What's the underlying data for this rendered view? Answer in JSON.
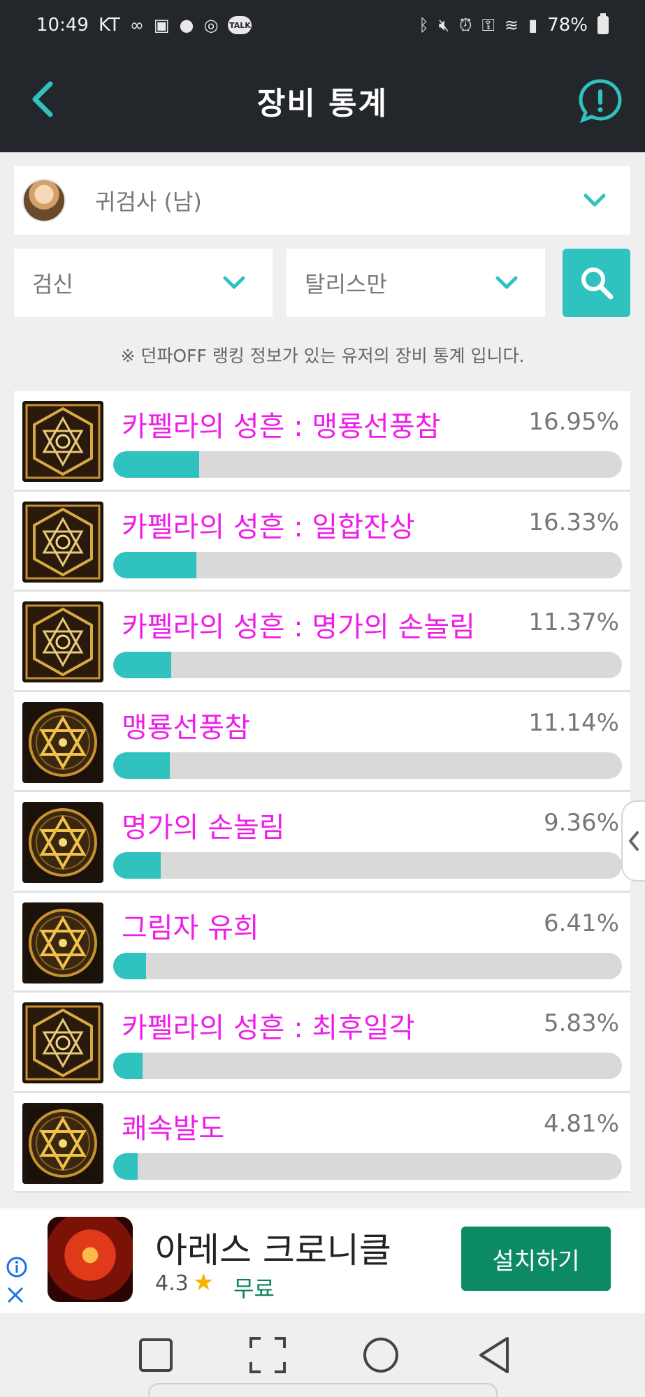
{
  "status_bar": {
    "time": "10:49",
    "carrier": "KT",
    "battery": "78%"
  },
  "header": {
    "title": "장비 통계"
  },
  "filters": {
    "class_label": "귀검사 (남)",
    "subclass": "검신",
    "option": "탈리스만"
  },
  "notice": "※ 던파OFF 랭킹 정보가 있는 유저의 장비 통계 입니다.",
  "stats": [
    {
      "name": "카펠라의 성흔 : 맹룡선풍참",
      "percent_label": "16.95%",
      "percent": 16.95,
      "icon": "capella-stigma-icon"
    },
    {
      "name": "카펠라의 성흔 : 일합잔상",
      "percent_label": "16.33%",
      "percent": 16.33,
      "icon": "capella-stigma-icon"
    },
    {
      "name": "카펠라의 성흔 : 명가의 손놀림",
      "percent_label": "11.37%",
      "percent": 11.37,
      "icon": "capella-stigma-icon"
    },
    {
      "name": "맹룡선풍참",
      "percent_label": "11.14%",
      "percent": 11.14,
      "icon": "talisman-icon"
    },
    {
      "name": "명가의 손놀림",
      "percent_label": "9.36%",
      "percent": 9.36,
      "icon": "talisman-icon"
    },
    {
      "name": "그림자 유희",
      "percent_label": "6.41%",
      "percent": 6.41,
      "icon": "talisman-icon"
    },
    {
      "name": "카펠라의 성흔 : 최후일각",
      "percent_label": "5.83%",
      "percent": 5.83,
      "icon": "capella-stigma-icon"
    },
    {
      "name": "쾌속발도",
      "percent_label": "4.81%",
      "percent": 4.81,
      "icon": "talisman-icon"
    }
  ],
  "ad": {
    "title": "아레스 크로니클",
    "rating": "4.3",
    "price": "무료",
    "install_label": "설치하기"
  },
  "colors": {
    "accent": "#2fc2be",
    "item_name": "#ee1ee8",
    "header_bg": "#23262b",
    "ad_button": "#0b8a64"
  }
}
